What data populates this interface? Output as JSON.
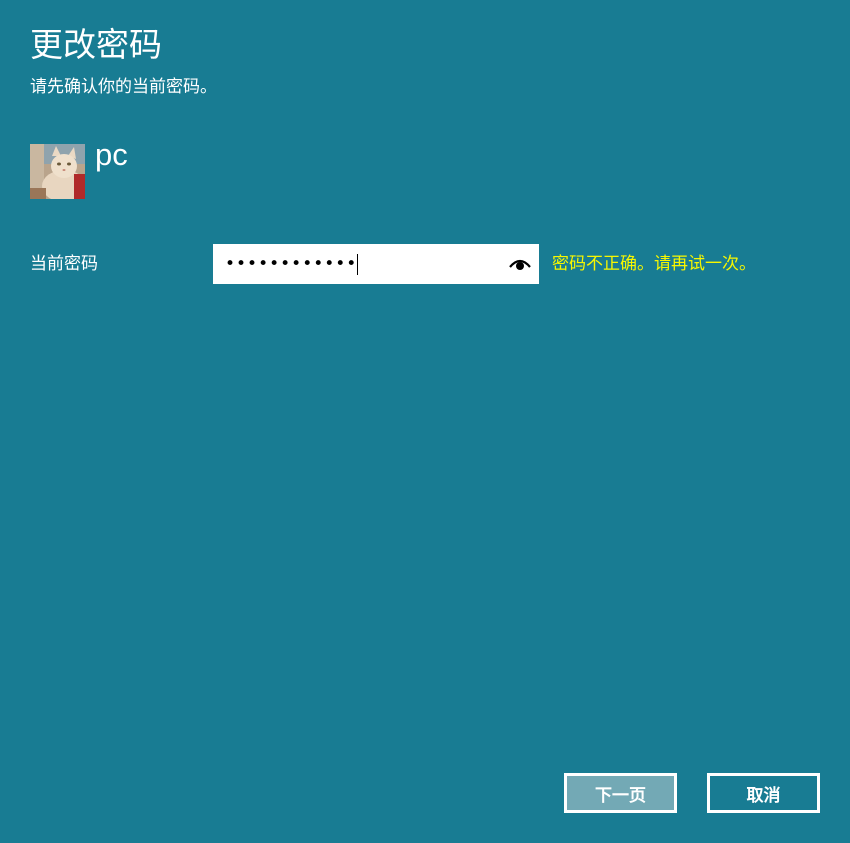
{
  "header": {
    "title": "更改密码",
    "subtitle": "请先确认你的当前密码。"
  },
  "user": {
    "name": "pc",
    "avatar_icon": "cat-photo-avatar"
  },
  "form": {
    "current_password_label": "当前密码",
    "password_value": "••••••••••••",
    "reveal_icon": "eye-icon",
    "error_message": "密码不正确。请再试一次。"
  },
  "buttons": {
    "next_label": "下一页",
    "cancel_label": "取消"
  },
  "colors": {
    "background": "#187c93",
    "error_text": "#f7f700",
    "next_button_fill": "#73a9b5",
    "text": "#ffffff"
  }
}
